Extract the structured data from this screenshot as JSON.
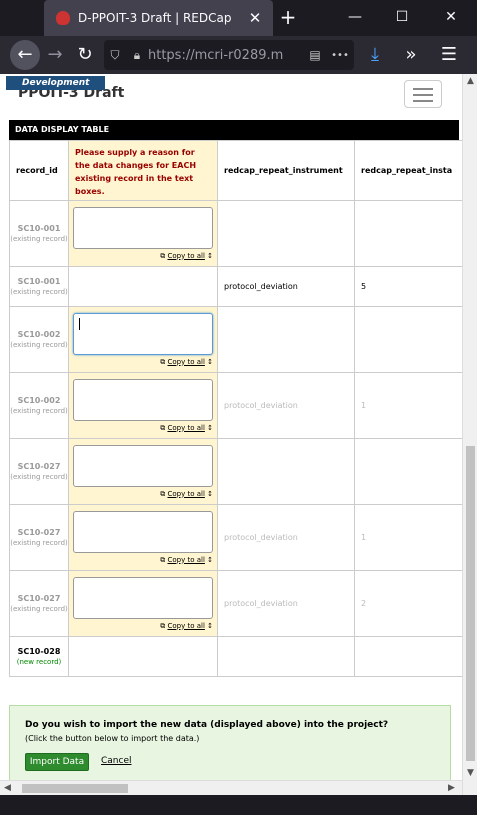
{
  "browser": {
    "tab_title": "D-PPOIT-3 Draft | REDCap",
    "close_glyph": "✕",
    "new_tab_glyph": "+",
    "url": "https://mcri-r0289.m",
    "minimize_glyph": "—",
    "maximize_glyph": "☐",
    "window_close_glyph": "✕",
    "more_glyph": "•••",
    "overflow_glyph": "»",
    "menu_glyph": "☰"
  },
  "header": {
    "badge": "Development",
    "project_title": "PPOIT-3 Draft"
  },
  "table": {
    "section_title": "DATA DISPLAY TABLE",
    "columns": {
      "record_id": "record_id",
      "reason": "Please supply a reason for the data changes for EACH existing record in the text boxes.",
      "instrument": "redcap_repeat_instrument",
      "instance": "redcap_repeat_insta"
    },
    "copy_label": "Copy to all",
    "rows": [
      {
        "id": "SC10-001",
        "status": "(existing record)",
        "instrument": "",
        "instance": ""
      },
      {
        "id": "SC10-001",
        "status": "(existing record)",
        "instrument": "protocol_deviation",
        "instance": "5"
      },
      {
        "id": "SC10-002",
        "status": "(existing record)",
        "instrument": "",
        "instance": ""
      },
      {
        "id": "SC10-002",
        "status": "(existing record)",
        "instrument": "protocol_deviation",
        "instance": "1"
      },
      {
        "id": "SC10-027",
        "status": "(existing record)",
        "instrument": "",
        "instance": ""
      },
      {
        "id": "SC10-027",
        "status": "(existing record)",
        "instrument": "protocol_deviation",
        "instance": "1"
      },
      {
        "id": "SC10-027",
        "status": "(existing record)",
        "instrument": "protocol_deviation",
        "instance": "2"
      },
      {
        "id": "SC10-028",
        "status": "(new record)",
        "instrument": "",
        "instance": ""
      }
    ]
  },
  "import": {
    "question": "Do you wish to import the new data (displayed above) into the project?",
    "hint": "(Click the button below to import the data.)",
    "button": "Import Data",
    "cancel": "Cancel"
  }
}
